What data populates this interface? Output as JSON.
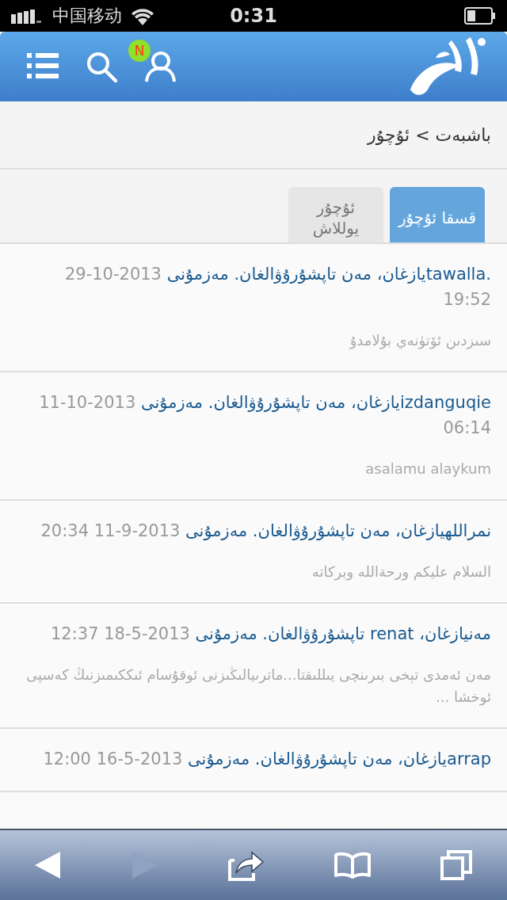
{
  "status_bar": {
    "carrier": "中国移动",
    "time": "0:31"
  },
  "header": {
    "notification_badge": "N"
  },
  "breadcrumb": "باشبەت > ئۇچۇر",
  "tabs": [
    {
      "label": "قسقا ئۇچۇر",
      "selected": true
    },
    {
      "label": "ئۇچۇر يوللاش",
      "selected": false
    }
  ],
  "messages": [
    {
      "title": ".tawallaيازغان، مەن تاپشۇرۇۋالغان. مەزمۇنى",
      "date": "2013-10-29 19:52",
      "body": "سىزدىن ئۆتۈنەي بۇلامدۇ"
    },
    {
      "title": "izdanguqieيازغان، مەن تاپشۇرۇۋالغان. مەزمۇنى",
      "date": "2013-10-11 06:14",
      "body": "asalamu alaykum"
    },
    {
      "title": "نمراللهيازغان، مەن تاپشۇرۇۋالغان. مەزمۇنى",
      "date": "2013-9-11 20:34",
      "body": "السلام عليكم ورحةالله وبركاته"
    },
    {
      "title": "مەنيازغان، renat تاپشۇرۇۋالغان. مەزمۇنى",
      "date": "2013-5-18 12:37",
      "body": "مەن ئەمدى تېخى بىرىنچى يىللىقتا...ماترىيالىڭىزنى ئوقۇسام ئىككىمىزنىڭ كەسپى ئوخشا ..."
    },
    {
      "title": "arrapيازغان، مەن تاپشۇرۇۋالغان. مەزمۇنى",
      "date": "2013-5-16 12:00"
    }
  ],
  "toolbar": [
    {
      "kind": "back",
      "disabled": false
    },
    {
      "kind": "forward",
      "disabled": true
    },
    {
      "kind": "share",
      "disabled": false
    },
    {
      "kind": "bookmarks",
      "disabled": false
    },
    {
      "kind": "tabs",
      "disabled": false
    }
  ]
}
